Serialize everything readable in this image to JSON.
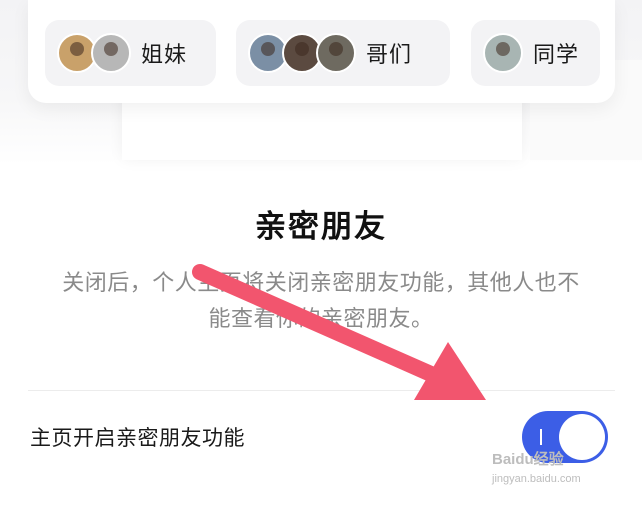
{
  "groups": [
    {
      "label": "姐妹",
      "avatar_colors": [
        "#c9a16a",
        "#b7b7b7"
      ]
    },
    {
      "label": "哥们",
      "avatar_colors": [
        "#7b8fa5",
        "#5b4a40",
        "#6e6a60"
      ]
    },
    {
      "label": "同学",
      "avatar_colors": [
        "#a8b5b3"
      ]
    }
  ],
  "section": {
    "title": "亲密朋友",
    "description": "关闭后，个人主页将关闭亲密朋友功能，其他人也不能查看你的亲密朋友。"
  },
  "setting": {
    "label": "主页开启亲密朋友功能",
    "toggle_on": true,
    "toggle_color": "#3c5ee6"
  },
  "annotation": {
    "arrow_color": "#f2556e"
  },
  "watermark": {
    "text": "Baidu经验",
    "sub": "jingyan.baidu.com"
  }
}
